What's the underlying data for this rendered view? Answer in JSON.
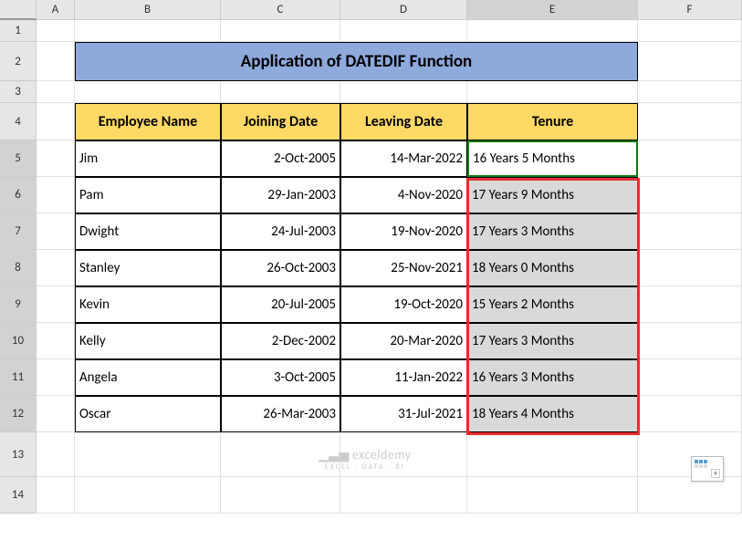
{
  "columns": [
    "A",
    "B",
    "C",
    "D",
    "E",
    "F"
  ],
  "rows": [
    "1",
    "2",
    "3",
    "4",
    "5",
    "6",
    "7",
    "8",
    "9",
    "10",
    "11",
    "12",
    "13",
    "14"
  ],
  "title": "Application of DATEDIF Function",
  "headers": {
    "name": "Employee Name",
    "join": "Joining Date",
    "leave": "Leaving Date",
    "tenure": "Tenure"
  },
  "data": [
    {
      "name": "Jim",
      "join": "2-Oct-2005",
      "leave": "14-Mar-2022",
      "tenure": "16 Years 5 Months"
    },
    {
      "name": "Pam",
      "join": "29-Jan-2003",
      "leave": "4-Nov-2020",
      "tenure": "17 Years 9 Months"
    },
    {
      "name": "Dwight",
      "join": "24-Jul-2003",
      "leave": "19-Nov-2020",
      "tenure": "17 Years 3 Months"
    },
    {
      "name": "Stanley",
      "join": "26-Oct-2003",
      "leave": "25-Nov-2021",
      "tenure": "18 Years 0 Months"
    },
    {
      "name": "Kevin",
      "join": "20-Jul-2005",
      "leave": "19-Oct-2020",
      "tenure": "15 Years 2 Months"
    },
    {
      "name": "Kelly",
      "join": "2-Dec-2002",
      "leave": "20-Mar-2020",
      "tenure": "17 Years 3 Months"
    },
    {
      "name": "Angela",
      "join": "3-Oct-2005",
      "leave": "11-Jan-2022",
      "tenure": "16 Years 3 Months"
    },
    {
      "name": "Oscar",
      "join": "26-Mar-2003",
      "leave": "31-Jul-2021",
      "tenure": "18 Years 4 Months"
    }
  ],
  "watermark": {
    "main": "exceldemy",
    "sub": "EXCEL · DATA · BI"
  }
}
